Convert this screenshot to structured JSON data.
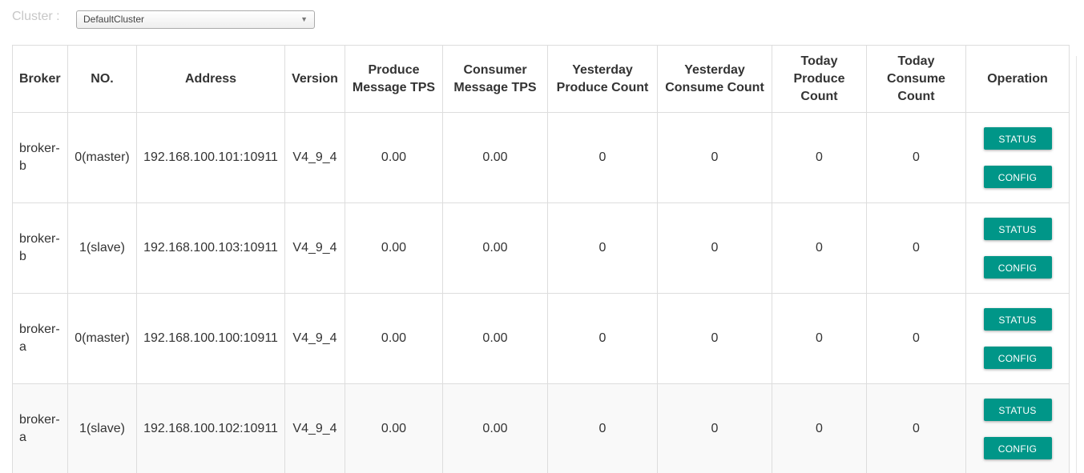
{
  "cluster": {
    "label": "Cluster :",
    "selected": "DefaultCluster",
    "caret_icon": "triangle-down"
  },
  "table": {
    "headers": {
      "broker": "Broker",
      "no": "NO.",
      "address": "Address",
      "version": "Version",
      "produce_tps": "Produce Message TPS",
      "consumer_tps": "Consumer Message TPS",
      "yesterday_produce": "Yesterday Produce Count",
      "yesterday_consume": "Yesterday Consume Count",
      "today_produce": "Today Produce Count",
      "today_consume": "Today Consume Count",
      "operation": "Operation"
    },
    "rows": [
      {
        "broker": "broker-b",
        "no": "0(master)",
        "address": "192.168.100.101:10911",
        "version": "V4_9_4",
        "produce_tps": "0.00",
        "consumer_tps": "0.00",
        "yesterday_produce": "0",
        "yesterday_consume": "0",
        "today_produce": "0",
        "today_consume": "0",
        "status_label": "STATUS",
        "config_label": "CONFIG"
      },
      {
        "broker": "broker-b",
        "no": "1(slave)",
        "address": "192.168.100.103:10911",
        "version": "V4_9_4",
        "produce_tps": "0.00",
        "consumer_tps": "0.00",
        "yesterday_produce": "0",
        "yesterday_consume": "0",
        "today_produce": "0",
        "today_consume": "0",
        "status_label": "STATUS",
        "config_label": "CONFIG"
      },
      {
        "broker": "broker-a",
        "no": "0(master)",
        "address": "192.168.100.100:10911",
        "version": "V4_9_4",
        "produce_tps": "0.00",
        "consumer_tps": "0.00",
        "yesterday_produce": "0",
        "yesterday_consume": "0",
        "today_produce": "0",
        "today_consume": "0",
        "status_label": "STATUS",
        "config_label": "CONFIG"
      },
      {
        "broker": "broker-a",
        "no": "1(slave)",
        "address": "192.168.100.102:10911",
        "version": "V4_9_4",
        "produce_tps": "0.00",
        "consumer_tps": "0.00",
        "yesterday_produce": "0",
        "yesterday_consume": "0",
        "today_produce": "0",
        "today_consume": "0",
        "status_label": "STATUS",
        "config_label": "CONFIG"
      }
    ]
  },
  "colors": {
    "button": "#009688",
    "border": "#dddddd",
    "label_muted": "#c7c7c7"
  }
}
